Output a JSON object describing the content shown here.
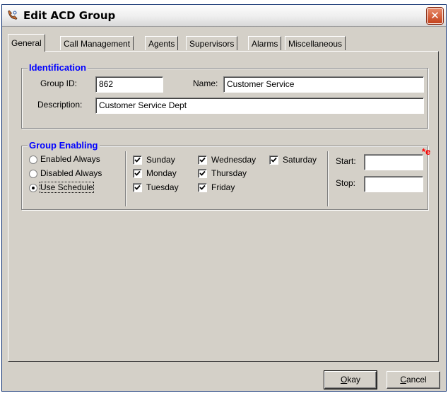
{
  "window": {
    "title": "Edit ACD Group",
    "close_symbol": "✕"
  },
  "tabs": [
    {
      "label": "General",
      "active": true
    },
    {
      "label": "Call Management",
      "active": false
    },
    {
      "label": "Agents",
      "active": false
    },
    {
      "label": "Supervisors",
      "active": false
    },
    {
      "label": "Alarms",
      "active": false
    },
    {
      "label": "Miscellaneous",
      "active": false
    }
  ],
  "identification": {
    "legend": "Identification",
    "group_id_label": "Group ID:",
    "group_id_value": "862",
    "name_label": "Name:",
    "name_value": "Customer Service",
    "description_label": "Description:",
    "description_value": "Customer Service Dept"
  },
  "enabling": {
    "legend": "Group Enabling",
    "radios": [
      {
        "label": "Enabled Always",
        "selected": false
      },
      {
        "label": "Disabled Always",
        "selected": false
      },
      {
        "label": "Use Schedule",
        "selected": true
      }
    ],
    "days": [
      {
        "label": "Sunday",
        "checked": true
      },
      {
        "label": "Monday",
        "checked": true
      },
      {
        "label": "Tuesday",
        "checked": true
      },
      {
        "label": "Wednesday",
        "checked": true
      },
      {
        "label": "Thursday",
        "checked": true
      },
      {
        "label": "Friday",
        "checked": true
      },
      {
        "label": "Saturday",
        "checked": true
      }
    ],
    "start_label": "Start:",
    "start_value": "",
    "stop_label": "Stop:",
    "stop_value": "",
    "required_marker": "*e"
  },
  "buttons": {
    "okay": "Okay",
    "okay_mnemonic": "O",
    "okay_rest": "kay",
    "cancel": "Cancel",
    "cancel_mnemonic": "C",
    "cancel_rest": "ancel"
  },
  "colors": {
    "legend": "#0000ff",
    "required": "#ff0000",
    "dialog_face": "#d4d0c8"
  },
  "icons": [
    "app-phone-icon",
    "close-icon",
    "radio-icon",
    "checkmark-icon"
  ]
}
